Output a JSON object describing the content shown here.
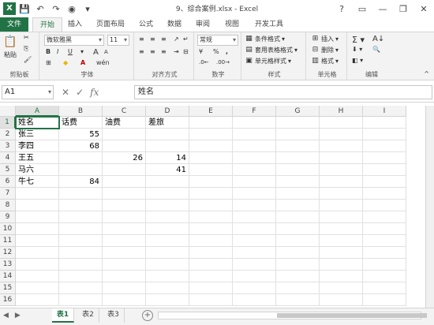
{
  "window": {
    "title": "9、综合案例.xlsx - Excel",
    "logo_letter": "X",
    "controls": [
      "?",
      "▭",
      "—",
      "❐",
      "✕"
    ]
  },
  "qat_icons": [
    "save-icon",
    "undo-icon",
    "redo-icon",
    "camera-icon",
    "customize-icon"
  ],
  "tabs": [
    "文件",
    "开始",
    "插入",
    "页面布局",
    "公式",
    "数据",
    "审阅",
    "视图",
    "开发工具"
  ],
  "active_tab": "开始",
  "ribbon": {
    "clipboard": {
      "label": "剪贴板",
      "paste": "粘贴"
    },
    "font": {
      "label": "字体",
      "font_name": "微软雅黑",
      "font_size": "11",
      "bold": "B",
      "italic": "I",
      "underline": "U",
      "grow": "A",
      "shrink": "A"
    },
    "alignment": {
      "label": "对齐方式"
    },
    "number": {
      "label": "数字",
      "format": "常规",
      "percent": "%",
      "comma": ","
    },
    "styles": {
      "label": "样式",
      "conditional": "条件格式",
      "table": "套用表格格式",
      "cell_styles": "单元格样式"
    },
    "cells": {
      "label": "单元格",
      "insert": "插入",
      "delete": "删除",
      "format": "格式"
    },
    "editing": {
      "label": "编辑"
    }
  },
  "formula_bar": {
    "name_box": "A1",
    "cancel": "✕",
    "enter": "✓",
    "fx": "fx",
    "content": "姓名"
  },
  "columns": [
    "A",
    "B",
    "C",
    "D",
    "E",
    "F",
    "G",
    "H",
    "I"
  ],
  "rows": [
    "1",
    "2",
    "3",
    "4",
    "5",
    "6",
    "7",
    "8",
    "9",
    "10",
    "11",
    "12",
    "13",
    "14",
    "15",
    "16"
  ],
  "cells": {
    "A1": "姓名",
    "B1": "话费",
    "C1": "油费",
    "D1": "差旅",
    "A2": "张三",
    "B2": "55",
    "A3": "李四",
    "B3": "68",
    "A4": "王五",
    "C4": "26",
    "D4": "14",
    "A5": "马六",
    "D5": "41",
    "A6": "牛七",
    "B6": "84"
  },
  "sheets": [
    "表1",
    "表2",
    "表3"
  ],
  "active_sheet": "表1",
  "colors": {
    "accent": "#217346"
  }
}
